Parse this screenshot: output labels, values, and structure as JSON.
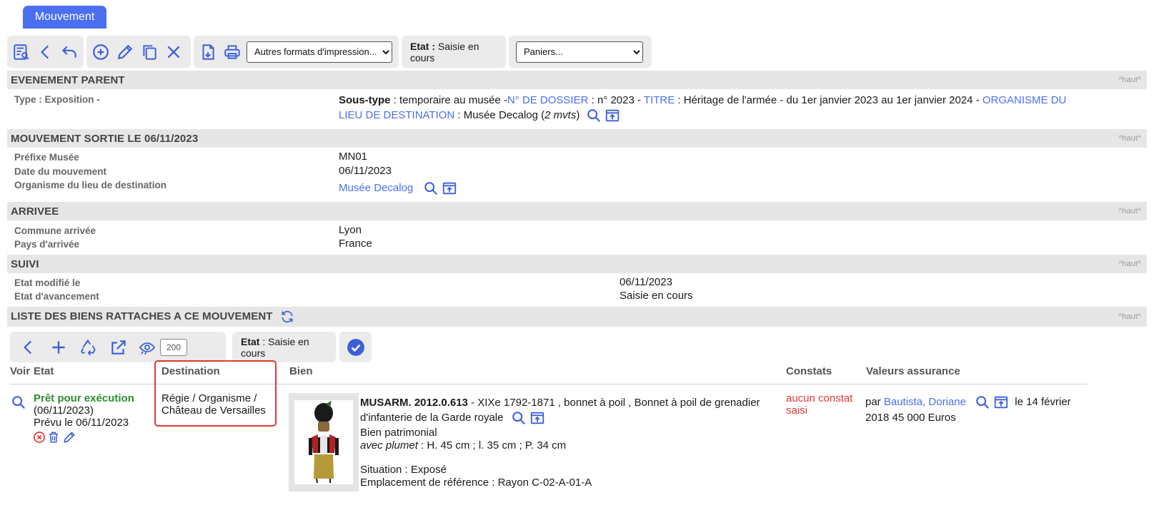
{
  "tab": {
    "label": "Mouvement"
  },
  "toolbar": {
    "print_formats": {
      "selected": "Autres formats d'impression..."
    },
    "etat": {
      "label": "Etat :",
      "value": "Saisie en cours"
    },
    "paniers": {
      "selected": "Paniers..."
    }
  },
  "haut_label": "^haut^",
  "evenement_parent": {
    "title": "EVENEMENT PARENT",
    "type_label": "Type : Exposition -",
    "soustype_label": "Sous-type",
    "soustype_value": " : temporaire au musée -",
    "dossier_label": "N° DE DOSSIER",
    "dossier_value": " : n° 2023 - ",
    "titre_label": "TITRE",
    "titre_value": " : Héritage de l'armée - du 1er janvier 2023 au 1er janvier 2024 - ",
    "organisme_label_1": "ORGANISME DU",
    "organisme_label_2": "LIEU DE DESTINATION",
    "organisme_value": " : Musée Decalog (",
    "mvts": "2 mvts",
    "close_paren": ")"
  },
  "mouvement": {
    "title": "MOUVEMENT SORTIE LE 06/11/2023",
    "prefixe_label": "Préfixe Musée",
    "prefixe_value": "MN01",
    "date_label": "Date du mouvement",
    "date_value": "06/11/2023",
    "organisme_label": "Organisme du lieu de destination",
    "organisme_value": "Musée Decalog"
  },
  "arrivee": {
    "title": "ARRIVEE",
    "commune_label": "Commune arrivée",
    "commune_value": "Lyon",
    "pays_label": "Pays d'arrivée",
    "pays_value": "France"
  },
  "suivi": {
    "title": "SUIVI",
    "modifie_label": "Etat modifié le",
    "modifie_value": "06/11/2023",
    "avancement_label": "Etat d'avancement",
    "avancement_value": "Saisie en cours"
  },
  "liste": {
    "title": "LISTE DES BIENS RATTACHES A CE MOUVEMENT",
    "page_size": "200",
    "etat_label": "Etat",
    "etat_value": " : Saisie en cours",
    "columns": {
      "voir": "Voir",
      "etat": "Etat",
      "destination": "Destination",
      "bien": "Bien",
      "constats": "Constats",
      "valeurs": "Valeurs assurance"
    },
    "row": {
      "status": "Prêt pour exécution",
      "status_date": "(06/11/2023)",
      "prevu": "Prévu le 06/11/2023",
      "destination_1": "Régie / Organisme /",
      "destination_2": "Château de Versailles",
      "inventory": "MUSARM. 2012.0.613",
      "desc_1": " - XIXe 1792-1871 , bonnet à poil , Bonnet à poil de grenadier",
      "desc_2": "d'infanterie de la Garde royale",
      "categorie": "Bien patrimonial",
      "plumet_label": "avec plumet",
      "dimensions": " : H. 45 cm ;  l. 35 cm ;  P. 34 cm",
      "situation": "Situation : Exposé",
      "emplacement": "Emplacement de référence : Rayon C-02-A-01-A",
      "constat": "aucun constat",
      "constat_2": "saisi",
      "valeur_par": "par ",
      "valeur_person": "Bautista, Doriane",
      "valeur_date": "le 14 février",
      "valeur_amount": "2018 45 000 Euros"
    }
  },
  "colors": {
    "accent": "#4b6ff0",
    "section_bg": "#e6e6e6",
    "toolbar_bg": "#ebebeb",
    "success": "#2e8b2e",
    "danger": "#e53935"
  }
}
